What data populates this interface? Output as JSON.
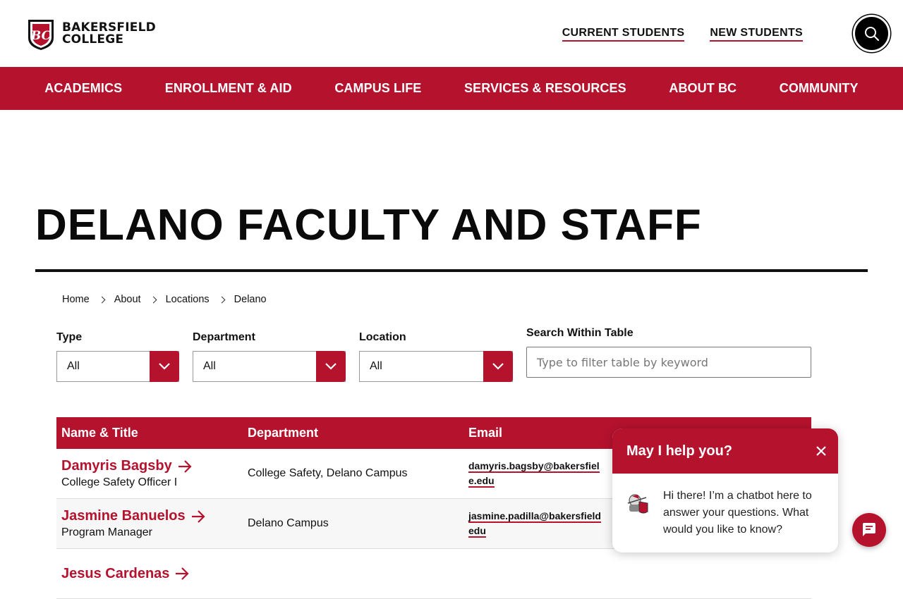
{
  "brand": {
    "line1": "BAKERSFIELD",
    "line2": "COLLEGE",
    "accent": "#b5122e"
  },
  "util_links": [
    "CURRENT STUDENTS",
    "NEW STUDENTS"
  ],
  "nav": [
    "ACADEMICS",
    "ENROLLMENT & AID",
    "CAMPUS LIFE",
    "SERVICES & RESOURCES",
    "ABOUT BC",
    "COMMUNITY"
  ],
  "page_title": "DELANO FACULTY AND STAFF",
  "breadcrumb": [
    "Home",
    "About",
    "Locations",
    "Delano"
  ],
  "filters": {
    "type": {
      "label": "Type",
      "value": "All"
    },
    "department": {
      "label": "Department",
      "value": "All"
    },
    "location": {
      "label": "Location",
      "value": "All"
    },
    "search": {
      "label": "Search Within Table",
      "placeholder": "Type to filter table by keyword"
    }
  },
  "table": {
    "headers": [
      "Name & Title",
      "Department",
      "Email"
    ],
    "rows": [
      {
        "name": "Damyris Bagsby",
        "title": "College Safety Officer I",
        "department": "College Safety, Delano Campus",
        "email_line1": "damyris.bagsby@bakersfiel",
        "email_line2": "e.edu"
      },
      {
        "name": "Jasmine Banuelos",
        "title": "Program Manager",
        "department": "Delano Campus",
        "email_line1": "jasmine.padilla@bakersfield",
        "email_line2": "edu"
      },
      {
        "name": "Jesus Cardenas",
        "title": "",
        "department": "",
        "email_line1": "",
        "email_line2": ""
      }
    ]
  },
  "chat": {
    "title": "May I help you?",
    "message": "Hi there! I’m a chatbot here to answer your questions. What would you like to know?"
  }
}
